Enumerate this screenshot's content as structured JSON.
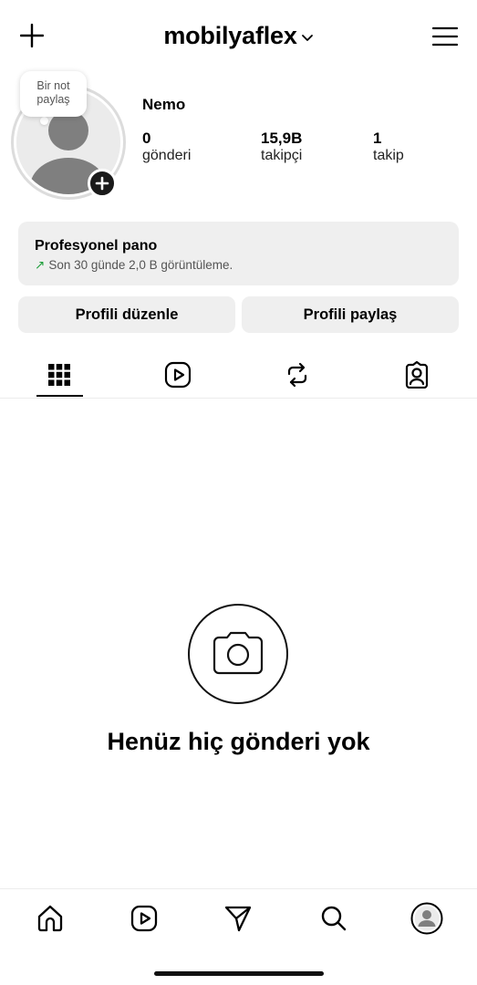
{
  "header": {
    "title": "mobilyaflex",
    "add_icon": "plus-icon",
    "menu_icon": "hamburger-menu-icon",
    "chevron_icon": "chevron-down-icon"
  },
  "note": {
    "line1": "Bir not",
    "line2": "paylaş"
  },
  "profile": {
    "name": "Nemo",
    "stats": [
      {
        "value": "0",
        "label": "gönderi"
      },
      {
        "value": "15,9B",
        "label": "takipçi"
      },
      {
        "value": "1",
        "label": "takip"
      }
    ]
  },
  "pro_panel": {
    "title": "Profesyonel pano",
    "arrow": "↗",
    "subtitle": "Son 30 günde 2,0 B görüntüleme.",
    "accent_color": "#1e9e3a"
  },
  "buttons": {
    "edit": "Profili düzenle",
    "share": "Profili paylaş"
  },
  "tabs": [
    {
      "icon": "grid-icon",
      "active": true
    },
    {
      "icon": "reels-icon",
      "active": false
    },
    {
      "icon": "repost-icon",
      "active": false
    },
    {
      "icon": "tagged-icon",
      "active": false
    }
  ],
  "empty_state": {
    "icon": "camera-icon",
    "text": "Henüz hiç gönderi yok"
  },
  "bottom_nav": [
    {
      "icon": "home-icon"
    },
    {
      "icon": "reels-icon"
    },
    {
      "icon": "send-icon"
    },
    {
      "icon": "search-icon"
    },
    {
      "icon": "profile-icon"
    }
  ]
}
